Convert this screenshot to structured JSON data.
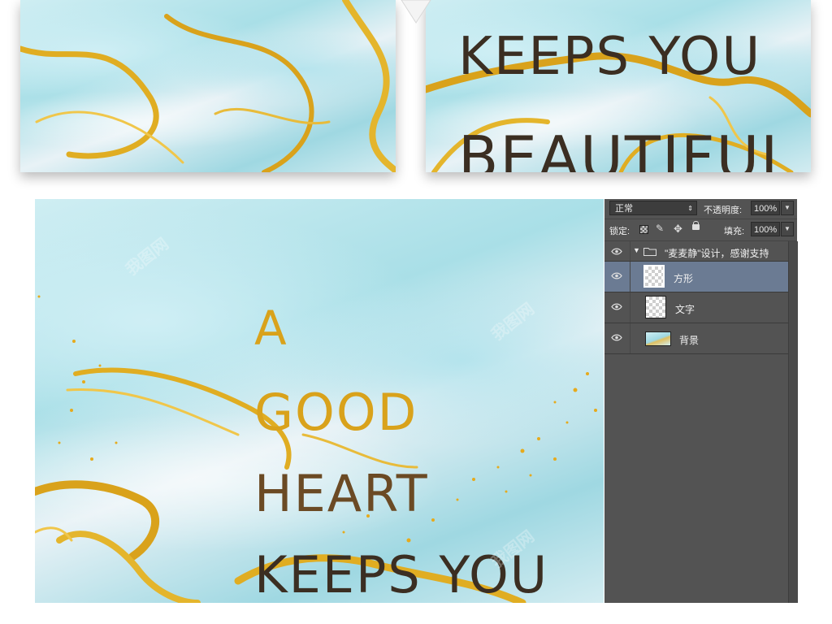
{
  "colors": {
    "gold": "#d9a21b",
    "text_dark": "#3b2e22",
    "panel_bg": "#535353",
    "selected_layer": "#6b7b93"
  },
  "top_right_panel": {
    "lines": [
      "KEEPS YOU",
      "BEAUTIFUL"
    ]
  },
  "main_artwork": {
    "lines": [
      "A",
      "GOOD",
      "HEART",
      "KEEPS YOU"
    ]
  },
  "layers_panel": {
    "blend_mode": "正常",
    "opacity_label": "不透明度:",
    "opacity_value": "100%",
    "lock_label": "锁定:",
    "fill_label": "填充:",
    "fill_value": "100%",
    "group_name": "\"麦麦静\"设计，感谢支持",
    "layers": [
      {
        "name": "方形",
        "selected": true,
        "thumb": "transparent-icon"
      },
      {
        "name": "文字",
        "selected": false,
        "thumb": "transparent-icon"
      },
      {
        "name": "背景",
        "selected": false,
        "thumb": "marble-thumb"
      }
    ]
  }
}
